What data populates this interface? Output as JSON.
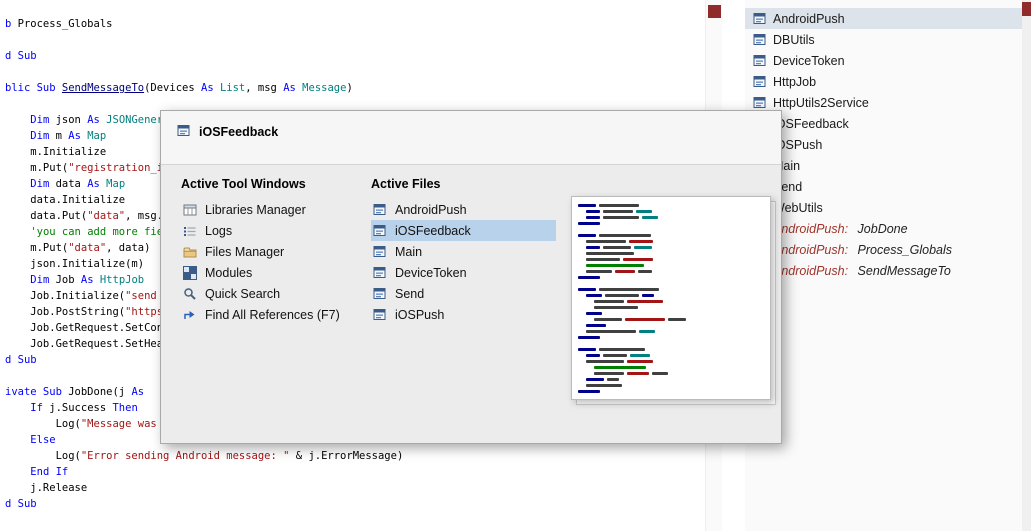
{
  "editor": {
    "lines": [
      [
        [
          "b",
          "kw"
        ],
        [
          " Process_Globals",
          "pl"
        ]
      ],
      [],
      [
        [
          "d Sub",
          "kw"
        ]
      ],
      [],
      [
        [
          "blic Sub ",
          "kw"
        ],
        [
          "SendMessageTo",
          "sub"
        ],
        [
          "(Devices ",
          "pl"
        ],
        [
          "As ",
          "kw"
        ],
        [
          "List",
          "ty"
        ],
        [
          ", msg ",
          "pl"
        ],
        [
          "As ",
          "kw"
        ],
        [
          "Message",
          "ty"
        ],
        [
          ")",
          "pl"
        ]
      ],
      [],
      [
        [
          "    ",
          "pl"
        ],
        [
          "Dim ",
          "kw"
        ],
        [
          "json ",
          "pl"
        ],
        [
          "As ",
          "kw"
        ],
        [
          "JSONGener",
          "ty"
        ]
      ],
      [
        [
          "    ",
          "pl"
        ],
        [
          "Dim ",
          "kw"
        ],
        [
          "m ",
          "pl"
        ],
        [
          "As ",
          "kw"
        ],
        [
          "Map",
          "ty"
        ]
      ],
      [
        [
          "    m.Initialize",
          "pl"
        ]
      ],
      [
        [
          "    m.Put(",
          "pl"
        ],
        [
          "\"registration_i",
          "str"
        ]
      ],
      [
        [
          "    ",
          "pl"
        ],
        [
          "Dim ",
          "kw"
        ],
        [
          "data ",
          "pl"
        ],
        [
          "As ",
          "kw"
        ],
        [
          "Map",
          "ty"
        ]
      ],
      [
        [
          "    data.Initialize",
          "pl"
        ]
      ],
      [
        [
          "    data.Put(",
          "pl"
        ],
        [
          "\"data\"",
          "str"
        ],
        [
          ", msg.",
          "pl"
        ]
      ],
      [
        [
          "    ",
          "pl"
        ],
        [
          "'you can add more fie",
          "com"
        ]
      ],
      [
        [
          "    m.Put(",
          "pl"
        ],
        [
          "\"data\"",
          "str"
        ],
        [
          ", data)",
          "pl"
        ]
      ],
      [
        [
          "    json.Initialize(m)",
          "pl"
        ]
      ],
      [
        [
          "    ",
          "pl"
        ],
        [
          "Dim ",
          "kw"
        ],
        [
          "Job ",
          "pl"
        ],
        [
          "As ",
          "kw"
        ],
        [
          "HttpJob",
          "ty"
        ]
      ],
      [
        [
          "    Job.Initialize(",
          "pl"
        ],
        [
          "\"send",
          "str"
        ]
      ],
      [
        [
          "    Job.PostString(",
          "pl"
        ],
        [
          "\"https",
          "str"
        ]
      ],
      [
        [
          "    Job.GetRequest.SetCon",
          "pl"
        ]
      ],
      [
        [
          "    Job.GetRequest.SetHea",
          "pl"
        ]
      ],
      [
        [
          "d Sub",
          "kw"
        ]
      ],
      [],
      [
        [
          "ivate Sub ",
          "kw"
        ],
        [
          "JobDone(j ",
          "pl"
        ],
        [
          "As",
          "kw"
        ]
      ],
      [
        [
          "    ",
          "pl"
        ],
        [
          "If ",
          "kw"
        ],
        [
          "j.Success ",
          "pl"
        ],
        [
          "Then",
          "kw"
        ]
      ],
      [
        [
          "        Log(",
          "pl"
        ],
        [
          "\"Message was",
          "str"
        ]
      ],
      [
        [
          "    ",
          "pl"
        ],
        [
          "Else",
          "kw"
        ]
      ],
      [
        [
          "        Log(",
          "pl"
        ],
        [
          "\"Error sending Android message: \" ",
          "str"
        ],
        [
          "& j.ErrorMessage)",
          "pl"
        ]
      ],
      [
        [
          "    ",
          "pl"
        ],
        [
          "End If",
          "kw"
        ]
      ],
      [
        [
          "    j.Release",
          "pl"
        ]
      ],
      [
        [
          "d Sub",
          "kw"
        ]
      ]
    ]
  },
  "right_panel": {
    "items": [
      {
        "icon": "module-icon",
        "label": "AndroidPush",
        "selected": true
      },
      {
        "icon": "module-icon",
        "label": "DBUtils"
      },
      {
        "icon": "module-icon",
        "label": "DeviceToken"
      },
      {
        "icon": "module-icon",
        "label": "HttpJob"
      },
      {
        "icon": "module-icon",
        "label": "HttpUtils2Service"
      },
      {
        "icon": "module-icon",
        "label": "iOSFeedback"
      },
      {
        "icon": "module-icon",
        "label": "iOSPush"
      },
      {
        "icon": "module-icon",
        "label": "Main"
      },
      {
        "icon": "module-icon",
        "label": "Send"
      },
      {
        "icon": "module-icon",
        "label": "WebUtils"
      },
      {
        "icon": "module-icon",
        "italic": true,
        "module": "AndroidPush:",
        "member": " JobDone"
      },
      {
        "icon": "module-icon",
        "italic": true,
        "module": "AndroidPush:",
        "member": " Process_Globals"
      },
      {
        "icon": "module-icon",
        "italic": true,
        "module": "AndroidPush:",
        "member": " SendMessageTo"
      }
    ]
  },
  "popup": {
    "title": "iOSFeedback",
    "icon": "module-icon",
    "tool_windows": {
      "header": "Active Tool Windows",
      "items": [
        {
          "icon": "libraries-icon",
          "label": "Libraries Manager"
        },
        {
          "icon": "logs-icon",
          "label": "Logs"
        },
        {
          "icon": "folder-icon",
          "label": "Files Manager"
        },
        {
          "icon": "modules-icon",
          "label": "Modules"
        },
        {
          "icon": "search-icon",
          "label": "Quick Search"
        },
        {
          "icon": "references-icon",
          "label": "Find All References (F7)"
        }
      ]
    },
    "active_files": {
      "header": "Active Files",
      "items": [
        {
          "icon": "module-icon",
          "label": "AndroidPush"
        },
        {
          "icon": "module-icon",
          "label": "iOSFeedback",
          "selected": true
        },
        {
          "icon": "module-icon",
          "label": "Main"
        },
        {
          "icon": "module-icon",
          "label": "DeviceToken"
        },
        {
          "icon": "module-icon",
          "label": "Send"
        },
        {
          "icon": "module-icon",
          "label": "iOSPush"
        }
      ]
    },
    "preview": {
      "colors": {
        "n": "#00008b",
        "t": "#008080",
        "m": "#a31515",
        "g": "#008000",
        "k": "#404040",
        "b": "#0000ff"
      },
      "lines": [
        {
          "i": 0,
          "s": [
            [
              18,
              "n"
            ],
            [
              40,
              "k"
            ]
          ]
        },
        {
          "i": 1,
          "s": [
            [
              14,
              "n"
            ],
            [
              30,
              "k"
            ],
            [
              16,
              "t"
            ]
          ]
        },
        {
          "i": 1,
          "s": [
            [
              14,
              "n"
            ],
            [
              36,
              "k"
            ],
            [
              16,
              "t"
            ]
          ]
        },
        {
          "i": 0,
          "s": [
            [
              22,
              "n"
            ]
          ]
        },
        {
          "i": 0,
          "s": []
        },
        {
          "i": 0,
          "s": [
            [
              18,
              "n"
            ],
            [
              52,
              "k"
            ]
          ]
        },
        {
          "i": 1,
          "s": [
            [
              40,
              "k"
            ],
            [
              24,
              "m"
            ]
          ]
        },
        {
          "i": 1,
          "s": [
            [
              14,
              "n"
            ],
            [
              28,
              "k"
            ],
            [
              18,
              "t"
            ]
          ]
        },
        {
          "i": 1,
          "s": [
            [
              48,
              "k"
            ]
          ]
        },
        {
          "i": 1,
          "s": [
            [
              34,
              "k"
            ],
            [
              30,
              "m"
            ]
          ]
        },
        {
          "i": 1,
          "s": [
            [
              58,
              "g"
            ]
          ]
        },
        {
          "i": 1,
          "s": [
            [
              26,
              "k"
            ],
            [
              20,
              "m"
            ],
            [
              14,
              "k"
            ]
          ]
        },
        {
          "i": 0,
          "s": [
            [
              22,
              "n"
            ]
          ]
        },
        {
          "i": 0,
          "s": []
        },
        {
          "i": 0,
          "s": [
            [
              18,
              "n"
            ],
            [
              60,
              "k"
            ]
          ]
        },
        {
          "i": 1,
          "s": [
            [
              16,
              "n"
            ],
            [
              34,
              "k"
            ],
            [
              12,
              "n"
            ]
          ]
        },
        {
          "i": 2,
          "s": [
            [
              30,
              "k"
            ],
            [
              36,
              "m"
            ]
          ]
        },
        {
          "i": 2,
          "s": [
            [
              44,
              "k"
            ]
          ]
        },
        {
          "i": 1,
          "s": [
            [
              16,
              "n"
            ]
          ]
        },
        {
          "i": 2,
          "s": [
            [
              28,
              "k"
            ],
            [
              40,
              "m"
            ],
            [
              18,
              "k"
            ]
          ]
        },
        {
          "i": 1,
          "s": [
            [
              20,
              "n"
            ]
          ]
        },
        {
          "i": 1,
          "s": [
            [
              50,
              "k"
            ],
            [
              16,
              "t"
            ]
          ]
        },
        {
          "i": 0,
          "s": [
            [
              22,
              "n"
            ]
          ]
        },
        {
          "i": 0,
          "s": []
        },
        {
          "i": 0,
          "s": [
            [
              18,
              "n"
            ],
            [
              46,
              "k"
            ]
          ]
        },
        {
          "i": 1,
          "s": [
            [
              14,
              "n"
            ],
            [
              24,
              "k"
            ],
            [
              20,
              "t"
            ]
          ]
        },
        {
          "i": 1,
          "s": [
            [
              38,
              "k"
            ],
            [
              26,
              "m"
            ]
          ]
        },
        {
          "i": 2,
          "s": [
            [
              52,
              "g"
            ]
          ]
        },
        {
          "i": 2,
          "s": [
            [
              30,
              "k"
            ],
            [
              22,
              "m"
            ],
            [
              16,
              "k"
            ]
          ]
        },
        {
          "i": 1,
          "s": [
            [
              18,
              "n"
            ],
            [
              12,
              "k"
            ]
          ]
        },
        {
          "i": 1,
          "s": [
            [
              36,
              "k"
            ]
          ]
        },
        {
          "i": 0,
          "s": [
            [
              22,
              "n"
            ]
          ]
        }
      ]
    }
  },
  "colors": {
    "keyword": "#0000ff",
    "type": "#008080",
    "string": "#a31515",
    "comment": "#008000",
    "sub_link": "#000080",
    "popup_selection": "#b9d2eb",
    "panel_selection": "#dde3ea",
    "scroll_marker": "#8f2b2b"
  }
}
